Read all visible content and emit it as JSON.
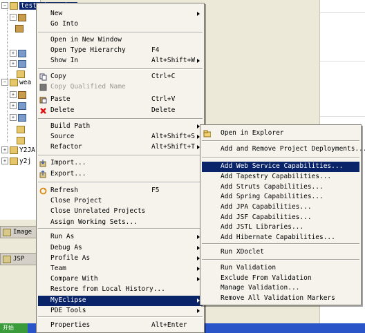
{
  "tree": {
    "selected_project": "testWebService",
    "project2_prefix": "wea",
    "node_y2": "Y2JA",
    "node_y2j": "y2j"
  },
  "panels": {
    "image_panel": "Image P",
    "jsp_tab": "JSP"
  },
  "taskbar": {
    "start": "开始"
  },
  "context_menu": {
    "items": [
      {
        "label": "New",
        "icon": "",
        "accel": "",
        "submenu": true
      },
      {
        "label": "Go Into",
        "icon": "",
        "accel": "",
        "submenu": false
      },
      {
        "label": "Open in New Window",
        "icon": "",
        "accel": "",
        "submenu": false
      },
      {
        "label": "Open Type Hierarchy",
        "icon": "",
        "accel": "F4",
        "submenu": false
      },
      {
        "label": "Show In",
        "icon": "",
        "accel": "Alt+Shift+W",
        "submenu": true
      },
      {
        "label": "Copy",
        "icon": "copy-icon",
        "accel": "Ctrl+C",
        "submenu": false
      },
      {
        "label": "Copy Qualified Name",
        "icon": "copy-qualified-icon",
        "accel": "",
        "submenu": false,
        "disabled": true
      },
      {
        "label": "Paste",
        "icon": "paste-icon",
        "accel": "Ctrl+V",
        "submenu": false
      },
      {
        "label": "Delete",
        "icon": "delete-icon",
        "accel": "Delete",
        "submenu": false
      },
      {
        "label": "Build Path",
        "icon": "",
        "accel": "",
        "submenu": true
      },
      {
        "label": "Source",
        "icon": "",
        "accel": "Alt+Shift+S",
        "submenu": true
      },
      {
        "label": "Refactor",
        "icon": "",
        "accel": "Alt+Shift+T",
        "submenu": true
      },
      {
        "label": "Import...",
        "icon": "import-icon",
        "accel": "",
        "submenu": false
      },
      {
        "label": "Export...",
        "icon": "export-icon",
        "accel": "",
        "submenu": false
      },
      {
        "label": "Refresh",
        "icon": "refresh-icon",
        "accel": "F5",
        "submenu": false
      },
      {
        "label": "Close Project",
        "icon": "",
        "accel": "",
        "submenu": false
      },
      {
        "label": "Close Unrelated Projects",
        "icon": "",
        "accel": "",
        "submenu": false
      },
      {
        "label": "Assign Working Sets...",
        "icon": "",
        "accel": "",
        "submenu": false
      },
      {
        "label": "Run As",
        "icon": "",
        "accel": "",
        "submenu": true
      },
      {
        "label": "Debug As",
        "icon": "",
        "accel": "",
        "submenu": true
      },
      {
        "label": "Profile As",
        "icon": "",
        "accel": "",
        "submenu": true
      },
      {
        "label": "Team",
        "icon": "",
        "accel": "",
        "submenu": true
      },
      {
        "label": "Compare With",
        "icon": "",
        "accel": "",
        "submenu": true
      },
      {
        "label": "Restore from Local History...",
        "icon": "",
        "accel": "",
        "submenu": false
      },
      {
        "label": "MyEclipse",
        "icon": "",
        "accel": "",
        "submenu": true,
        "highlighted": true
      },
      {
        "label": "PDE Tools",
        "icon": "",
        "accel": "",
        "submenu": true
      },
      {
        "label": "Properties",
        "icon": "",
        "accel": "Alt+Enter",
        "submenu": false
      }
    ]
  },
  "myeclipse_menu": {
    "items": [
      {
        "label": "Open in Explorer",
        "icon": "explorer-icon"
      },
      {
        "label": "Add and Remove Project Deployments..."
      },
      {
        "label": "Add Web Service Capabilities...",
        "highlighted": true
      },
      {
        "label": "Add Tapestry Capabilities..."
      },
      {
        "label": "Add Struts Capabilities..."
      },
      {
        "label": "Add Spring Capabilities..."
      },
      {
        "label": "Add JPA Capabilities..."
      },
      {
        "label": "Add JSF Capabilities..."
      },
      {
        "label": "Add JSTL Libraries..."
      },
      {
        "label": "Add Hibernate Capabilities..."
      },
      {
        "label": "Run XDoclet"
      },
      {
        "label": "Run Validation"
      },
      {
        "label": "Exclude From Validation"
      },
      {
        "label": "Manage Validation..."
      },
      {
        "label": "Remove All Validation Markers"
      }
    ]
  },
  "colors": {
    "highlight": "#0a246a",
    "menu_bg": "#f5f3ec",
    "disabled_text": "#9a988e"
  }
}
